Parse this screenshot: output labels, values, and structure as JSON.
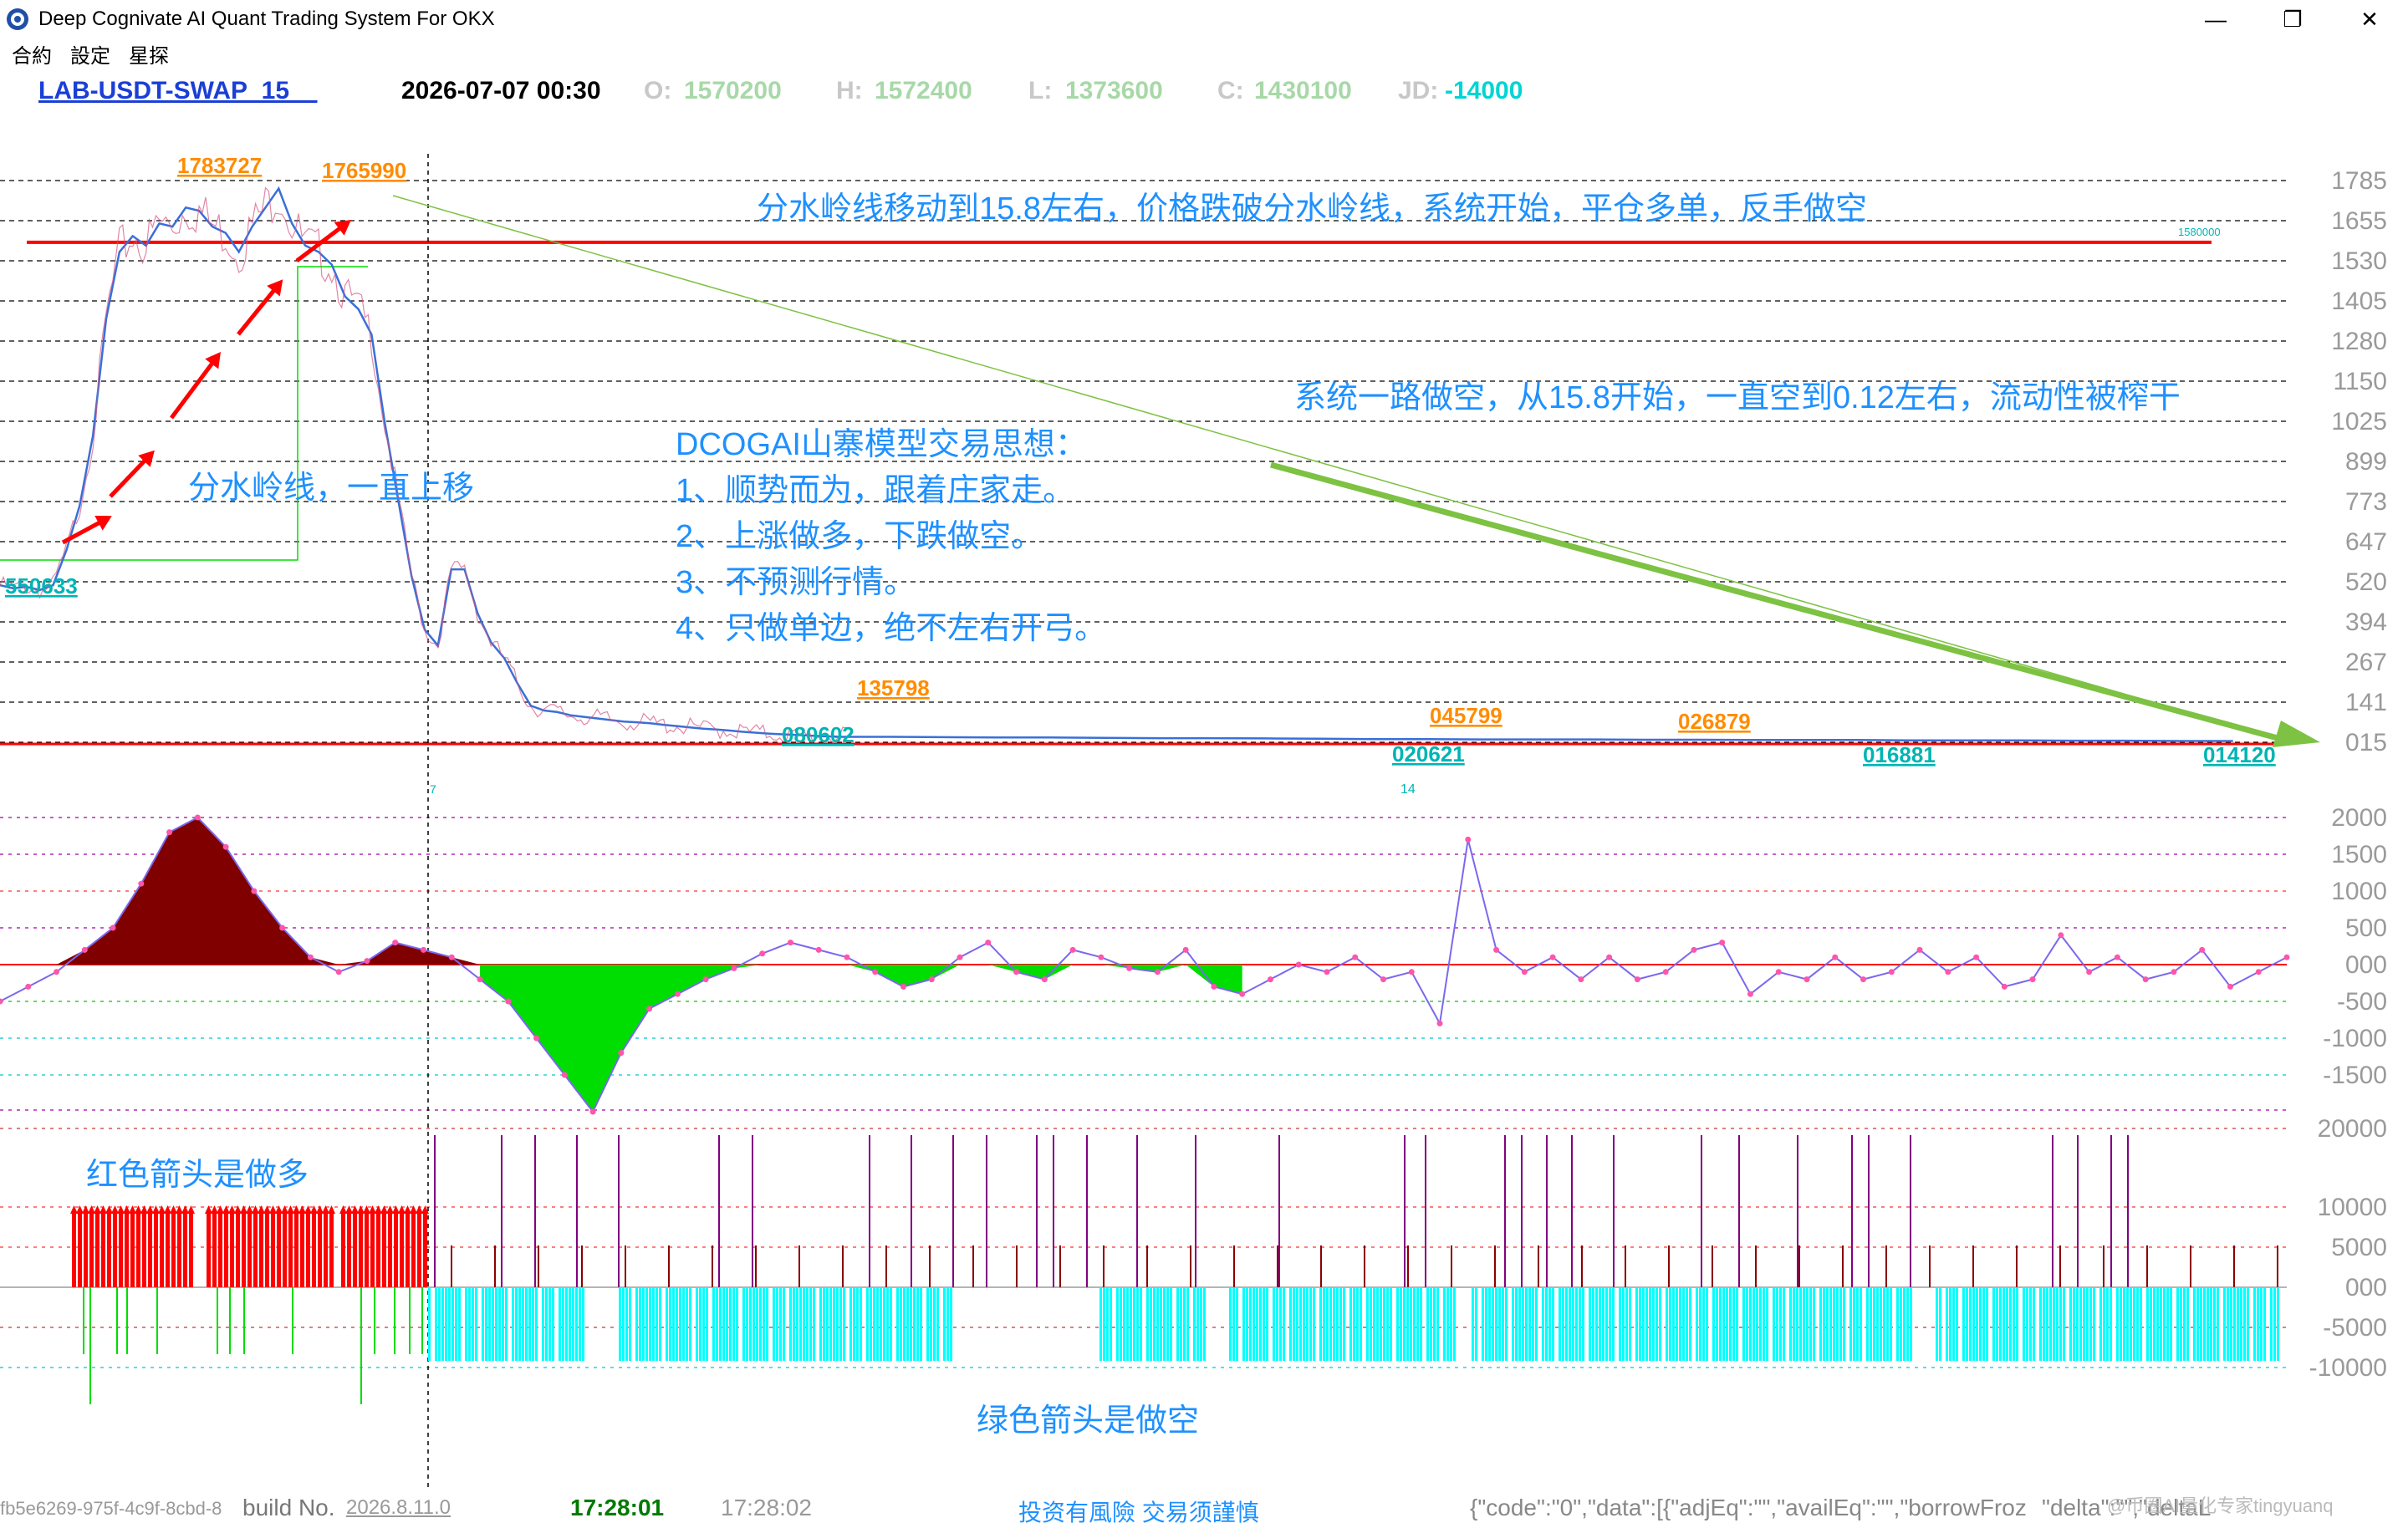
{
  "window": {
    "title": "Deep Cognivate AI Quant Trading System For OKX",
    "minimize_glyph": "—",
    "restore_glyph": "❐",
    "close_glyph": "✕"
  },
  "menu": [
    "合約",
    "設定",
    "星探"
  ],
  "info": {
    "symbol": "LAB-USDT-SWAP_15__",
    "datetime": "2026-07-07 00:30",
    "open_label": "O:",
    "open_value": "1570200",
    "high_label": "H:",
    "high_value": "1572400",
    "low_label": "L:",
    "low_value": "1373600",
    "close_label": "C:",
    "close_value": "1430100",
    "jd_label": "JD:",
    "jd_value": "-14000"
  },
  "colors": {
    "symbol": "#1a3fd6",
    "ohlc_label": "#c8c8c8",
    "ohlc_value": "#a8d8a8",
    "jd_value": "#00d4d4",
    "annotation": "#1e90ff",
    "peak_label": "#ff8c00",
    "trough_label": "#00b4b4",
    "red": "#ff0000",
    "green": "#00dd00",
    "cyan": "#00ffff",
    "maroon": "#800000",
    "purple": "#800080",
    "trend": "#7dc242"
  },
  "chart_data": {
    "type": "line",
    "price_panel": {
      "y_ticks": [
        "1785",
        "1655",
        "1530",
        "1405",
        "1280",
        "1150",
        "1025",
        "899",
        "773",
        "647",
        "520",
        "394",
        "267",
        "141",
        "015"
      ],
      "watershed_label": "1580000",
      "peak_labels": [
        "1783727",
        "1765990",
        "135798",
        "045799",
        "026879"
      ],
      "trough_labels": [
        "550633",
        "080602",
        "020621",
        "016881",
        "014120"
      ],
      "small_labels": [
        "7",
        "14"
      ],
      "close": [
        510,
        500,
        505,
        495,
        510,
        620,
        760,
        980,
        1350,
        1560,
        1610,
        1580,
        1650,
        1640,
        1700,
        1690,
        1640,
        1620,
        1560,
        1640,
        1700,
        1760,
        1650,
        1580,
        1560,
        1520,
        1420,
        1380,
        1300,
        1020,
        780,
        540,
        370,
        320,
        560,
        560,
        420,
        330,
        280,
        200,
        130,
        115,
        110,
        100,
        95,
        90,
        85,
        80,
        78,
        75,
        70,
        66,
        62,
        58,
        55,
        52,
        48,
        45,
        42,
        40,
        38,
        36,
        34,
        33,
        32,
        32,
        31,
        30,
        30,
        29,
        28,
        28,
        27,
        26,
        25,
        25,
        24,
        24,
        24,
        23,
        23,
        22,
        22,
        22,
        21,
        21,
        21,
        20,
        20,
        19,
        19
      ]
    },
    "oscillator_panel": {
      "y_ticks": [
        "2000",
        "1500",
        "1000",
        "500",
        "000",
        "-500",
        "-1000",
        "-1500"
      ],
      "values": [
        -500,
        -300,
        -100,
        200,
        500,
        1100,
        1800,
        2000,
        1600,
        1000,
        500,
        100,
        -100,
        50,
        300,
        200,
        100,
        -200,
        -500,
        -1000,
        -1500,
        -2000,
        -1200,
        -600,
        -400,
        -200,
        -50,
        150,
        300,
        200,
        100,
        -100,
        -300,
        -200,
        100,
        300,
        -100,
        -200,
        200,
        100,
        -50,
        -100,
        200,
        -300,
        -400,
        -200,
        0,
        -100,
        100,
        -200,
        -100,
        -800,
        1700,
        200,
        -100,
        100,
        -200,
        100,
        -200,
        -100,
        200,
        300,
        -400,
        -100,
        -200,
        100,
        -200,
        -100,
        200,
        -100,
        100,
        -300,
        -200,
        400,
        -100,
        100,
        -200,
        -100,
        200,
        -300,
        -100,
        100
      ]
    },
    "signal_panel": {
      "y_ticks": [
        "20000",
        "10000",
        "5000",
        "000",
        "-5000",
        "-10000"
      ]
    }
  },
  "annotations": {
    "top": "分水岭线移动到15.8左右，价格跌破分水岭线，系统开始，平仓多单，反手做空",
    "right": "系统一路做空，从15.8开始，一直空到0.12左右，流动性被榨干",
    "left": "分水岭线，一直上移",
    "thought_lines": [
      "DCOGAI山寨模型交易思想：",
      "1、顺势而为，跟着庄家走。",
      "2、上涨做多，下跌做空。",
      "3、不预测行情。",
      "4、只做单边，绝不左右开弓。"
    ],
    "red_arrow_note": "红色箭头是做多",
    "green_arrow_note": "绿色箭头是做空"
  },
  "status": {
    "id_fragment": "fb5e6269-975f-4c9f-8cbd-8",
    "build_label": "build No.",
    "build_value": "2026.8.11.0",
    "time1": "17:28:01",
    "time2": "17:28:02",
    "risk": "投资有風險 交易须謹慎",
    "json_text": "{\"code\":\"0\",\"data\":[{\"adjEq\":\"\",\"availEq\":\"\",\"borrowFroz",
    "json_tail": "\"delta\":\"\",\"deltaL",
    "watermark": "@币圈AI量化专家tingyuanq"
  }
}
